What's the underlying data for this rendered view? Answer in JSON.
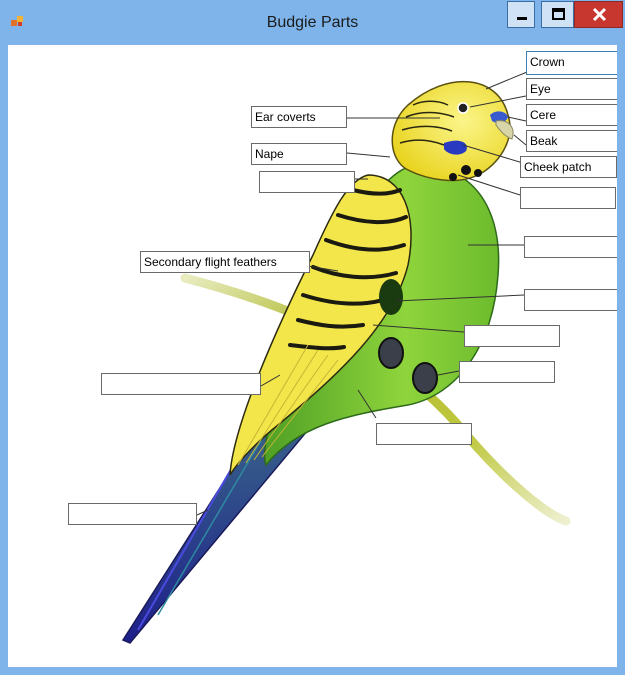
{
  "window": {
    "title": "Budgie Parts",
    "minimize_glyph": "minimize-icon",
    "maximize_glyph": "maximize-icon",
    "close_glyph": "close-icon"
  },
  "labels": {
    "crown": "Crown",
    "eye": "Eye",
    "cere": "Cere",
    "beak": "Beak",
    "cheek_patch": "Cheek patch",
    "ear_coverts": "Ear coverts",
    "nape": "Nape",
    "secondary_flight_feathers": "Secondary flight feathers",
    "blank_1": "",
    "blank_2": "",
    "blank_3": "",
    "blank_4": "",
    "blank_5": "",
    "blank_6": "",
    "blank_7": "",
    "blank_8": "",
    "blank_9": ""
  },
  "colors": {
    "title_bar": "#7eb4ea",
    "close_button": "#c7372f",
    "head_yellow": "#f6ee3a",
    "body_green": "#8fd43c",
    "tail_blue": "#2a2f9a"
  }
}
